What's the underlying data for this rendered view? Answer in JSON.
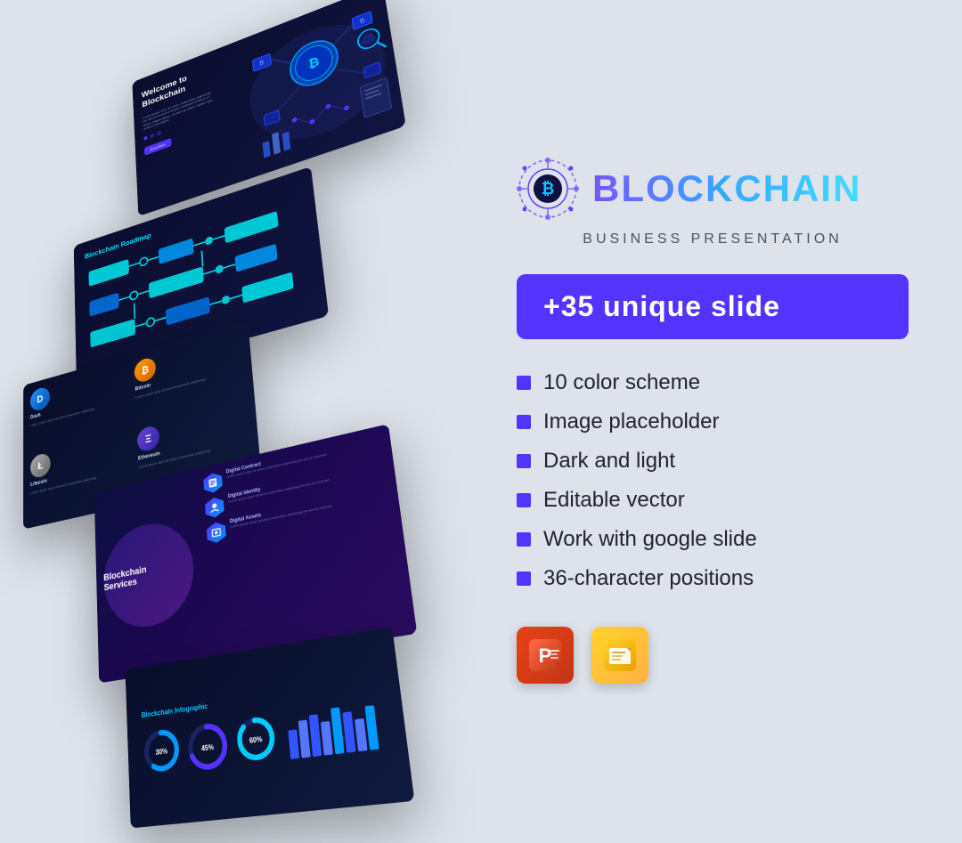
{
  "brand": {
    "title": "BLOCKCHAIN",
    "subtitle": "BUSINESS PRESENTATION",
    "badge": "+35 unique slide"
  },
  "features": [
    {
      "id": "color-scheme",
      "label": "10 color scheme"
    },
    {
      "id": "image-placeholder",
      "label": "Image placeholder"
    },
    {
      "id": "dark-and-light",
      "label": "Dark and light"
    },
    {
      "id": "editable-vector",
      "label": "Editable vector"
    },
    {
      "id": "google-slide",
      "label": "Work with google slide"
    },
    {
      "id": "character-positions",
      "label": "36-character positions"
    }
  ],
  "slides": {
    "slide1": {
      "title": "Welcome to",
      "subtitle": "Blockchain",
      "description": "Lorem ipsum dolor sit amet consectetur adipiscing elit sed do eiusmod tempor",
      "btn_label": "Read More"
    },
    "slide2": {
      "title": "Blockchain Roadmap"
    },
    "slide3": {
      "cryptos": [
        {
          "symbol": "D",
          "name": "Dash",
          "color": "#1e90ff"
        },
        {
          "symbol": "L",
          "name": "Litecoin",
          "color": "#aaaaaa"
        },
        {
          "symbol": "Ξ",
          "name": "Ethereum",
          "color": "#6644cc"
        },
        {
          "symbol": "₿",
          "name": "Bitcoin",
          "color": "#ff9900"
        }
      ]
    },
    "slide4": {
      "title": "Blockchain Services",
      "services": [
        {
          "name": "Digital Contract",
          "desc": "Lorem ipsum dolor sit amet consectetur"
        },
        {
          "name": "Digital Identity",
          "desc": "Lorem ipsum dolor sit amet consectetur"
        },
        {
          "name": "Digital Assets",
          "desc": "Lorem ipsum dolor sit amet consectetur"
        }
      ]
    },
    "slide5": {
      "title": "Blockchain Infographic",
      "circles": [
        {
          "value": "30%",
          "label": ""
        },
        {
          "value": "45%",
          "label": ""
        },
        {
          "value": "60%",
          "label": ""
        }
      ],
      "bars": [
        35,
        55,
        70,
        45,
        80,
        60,
        40,
        65
      ]
    }
  },
  "apps": {
    "powerpoint_label": "P",
    "gslides_label": "G"
  }
}
